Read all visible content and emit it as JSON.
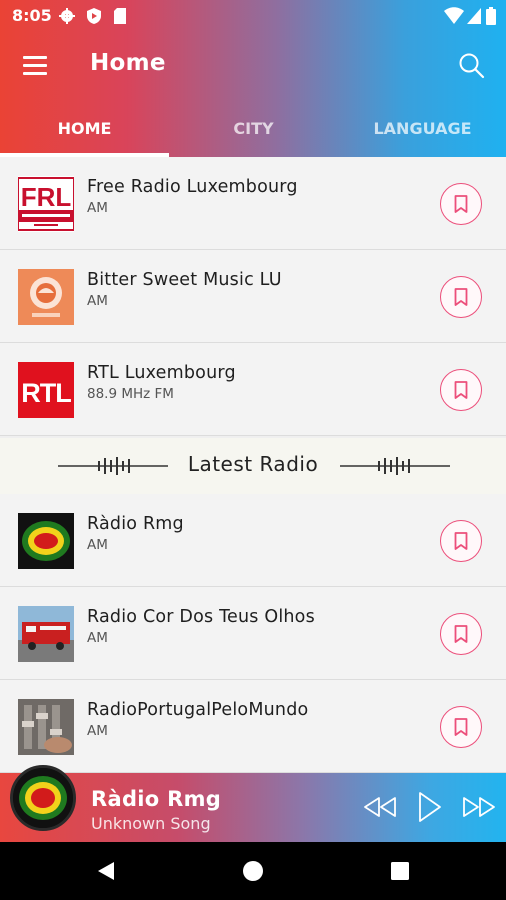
{
  "status": {
    "time": "8:05"
  },
  "app": {
    "title": "Home"
  },
  "tabs": [
    {
      "label": "HOME"
    },
    {
      "label": "CITY"
    },
    {
      "label": "LANGUAGE"
    }
  ],
  "featured": [
    {
      "name": "Free Radio Luxembourg",
      "band": "AM",
      "logo_text": "FRL"
    },
    {
      "name": "Bitter Sweet Music LU",
      "band": "AM"
    },
    {
      "name": "RTL Luxembourg",
      "band": "88.9 MHz FM",
      "logo_text": "RTL"
    }
  ],
  "section": {
    "title": "Latest Radio"
  },
  "latest": [
    {
      "name": "Ràdio Rmg",
      "band": "AM"
    },
    {
      "name": "Radio Cor Dos Teus Olhos",
      "band": "AM"
    },
    {
      "name": "RadioPortugalPeloMundo",
      "band": "AM"
    }
  ],
  "player": {
    "title": "Ràdio Rmg",
    "subtitle": "Unknown Song"
  },
  "colors": {
    "accent_pink": "#ec4f7b",
    "header_start": "#ea4335",
    "header_end": "#1fb1f0"
  },
  "icons": [
    "menu-icon",
    "search-icon",
    "bookmark-icon",
    "rewind-icon",
    "play-icon",
    "fast-forward-icon",
    "back-icon",
    "home-circle-icon",
    "recents-square-icon"
  ]
}
